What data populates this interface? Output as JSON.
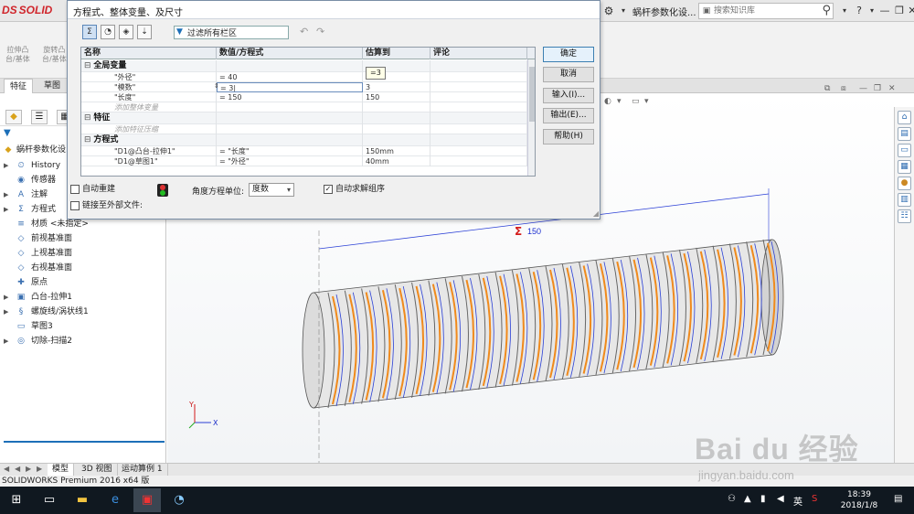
{
  "app": {
    "logo_text": "SOLID",
    "logo_ds": "DS",
    "doc_title": "蜗杆参数化设...",
    "search_placeholder": "搜索知识库",
    "help": "?",
    "minimize": "—",
    "restore": "❐",
    "close": "✕"
  },
  "command_manager": {
    "items": [
      "拉伸凸\n台/基体",
      "旋转凸\n台/基体"
    ]
  },
  "tabs": [
    "特征",
    "草图"
  ],
  "feature_tree": {
    "root": "蜗杆参数化设...",
    "items": [
      {
        "label": "History",
        "icon": "history-icon",
        "glyph": "⏲",
        "expandable": true
      },
      {
        "label": "传感器",
        "icon": "sensor-icon",
        "glyph": "◉",
        "expandable": false
      },
      {
        "label": "注解",
        "icon": "annotation-icon",
        "glyph": "A",
        "expandable": true
      },
      {
        "label": "方程式",
        "icon": "equation-icon",
        "glyph": "Σ",
        "expandable": true
      },
      {
        "label": "材质 <未指定>",
        "icon": "material-icon",
        "glyph": "≡",
        "expandable": false
      },
      {
        "label": "前视基准面",
        "icon": "plane-icon",
        "glyph": "◇",
        "expandable": false
      },
      {
        "label": "上视基准面",
        "icon": "plane-icon",
        "glyph": "◇",
        "expandable": false
      },
      {
        "label": "右视基准面",
        "icon": "plane-icon",
        "glyph": "◇",
        "expandable": false
      },
      {
        "label": "原点",
        "icon": "origin-icon",
        "glyph": "✚",
        "expandable": false
      },
      {
        "label": "凸台-拉伸1",
        "icon": "extrude-icon",
        "glyph": "▣",
        "expandable": true
      },
      {
        "label": "螺旋线/涡状线1",
        "icon": "helix-icon",
        "glyph": "§",
        "expandable": true
      },
      {
        "label": "草图3",
        "icon": "sketch-icon",
        "glyph": "▭",
        "expandable": false
      },
      {
        "label": "切除-扫描2",
        "icon": "cut-sweep-icon",
        "glyph": "◎",
        "expandable": true
      }
    ]
  },
  "bottom_tabs": [
    "模型",
    "3D 视图",
    "运动算例 1"
  ],
  "status_text": "SOLIDWORKS Premium 2016 x64 版",
  "viewport": {
    "dimension_value": "150",
    "dimension_symbol": "Σ",
    "axis_x": "X",
    "axis_y": "Y"
  },
  "dialog": {
    "title": "方程式、整体变量、及尺寸",
    "filter_value": "过滤所有栏区",
    "columns": [
      "名称",
      "数值/方程式",
      "估算到",
      "评论"
    ],
    "sections": [
      {
        "title": "全局变量",
        "rows": [
          {
            "name": "\"外径\"",
            "value": "= 40",
            "eval": "40",
            "comment": ""
          },
          {
            "name": "\"模数\"",
            "value": "= 3|",
            "eval": "3",
            "comment": "",
            "editing": true
          },
          {
            "name": "\"长度\"",
            "value": "= 150",
            "eval": "150",
            "comment": ""
          }
        ],
        "add_hint": "添加整体变量"
      },
      {
        "title": "特征",
        "rows": [],
        "add_hint": "添加特征压缩"
      },
      {
        "title": "方程式",
        "rows": [
          {
            "name": "\"D1@凸台-拉伸1\"",
            "value": "= \"长度\"",
            "eval": "150mm",
            "comment": ""
          },
          {
            "name": "\"D1@草图1\"",
            "value": "= \"外径\"",
            "eval": "40mm",
            "comment": ""
          }
        ],
        "add_hint": ""
      }
    ],
    "tooltip": "=3",
    "buttons": {
      "ok": "确定",
      "cancel": "取消",
      "import": "输入(I)...",
      "export": "输出(E)...",
      "help": "帮助(H)"
    },
    "auto_rebuild": {
      "label": "自动重建",
      "checked": false
    },
    "link_external": {
      "label": "链接至外部文件:",
      "checked": false
    },
    "angle_unit_label": "角度方程单位:",
    "angle_unit_value": "度数",
    "auto_solve": {
      "label": "自动求解组序",
      "checked": true
    }
  },
  "taskbar": {
    "time": "18:39",
    "date": "2018/1/8",
    "ime": "英"
  },
  "watermark": {
    "logo": "Bai du 经验",
    "url": "jingyan.baidu.com"
  },
  "colors": {
    "accent_blue": "#1d6fb8",
    "worm_orange": "#f08a1c",
    "worm_blue": "#2a3fd6",
    "dimension_red": "#d41b1b"
  }
}
